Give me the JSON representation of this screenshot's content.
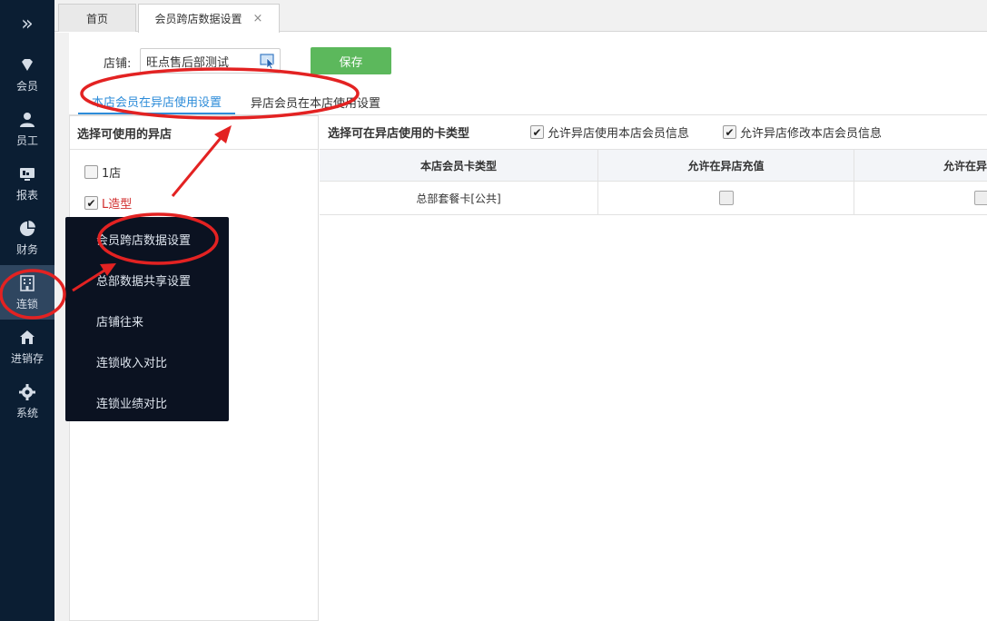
{
  "sidebar": {
    "toggle_icon": "double-chevron-right-icon",
    "items": [
      {
        "label": "会员",
        "icon": "diamond-icon"
      },
      {
        "label": "员工",
        "icon": "user-icon"
      },
      {
        "label": "报表",
        "icon": "monitor-icon"
      },
      {
        "label": "财务",
        "icon": "pie-chart-icon"
      },
      {
        "label": "连锁",
        "icon": "building-icon"
      },
      {
        "label": "进销存",
        "icon": "house-icon"
      },
      {
        "label": "系统",
        "icon": "gear-icon"
      }
    ],
    "active_index": 4
  },
  "tabs": [
    {
      "label": "首页"
    },
    {
      "label": "会员跨店数据设置",
      "close": "×"
    }
  ],
  "form": {
    "store_label": "店铺:",
    "store_value": "旺点售后部测试",
    "save_label": "保存"
  },
  "subtabs": [
    {
      "label": "本店会员在异店使用设置"
    },
    {
      "label": "异店会员在本店使用设置"
    }
  ],
  "left_panel": {
    "title": "选择可使用的异店",
    "stores": [
      {
        "name": "1店",
        "checked": false
      },
      {
        "name": "L造型",
        "checked": true
      }
    ]
  },
  "right_panel": {
    "title": "选择可在异店使用的卡类型",
    "options": [
      {
        "label": "允许异店使用本店会员信息",
        "checked": true
      },
      {
        "label": "允许异店修改本店会员信息",
        "checked": true
      }
    ],
    "columns": [
      "本店会员卡类型",
      "允许在异店充值",
      "允许在异"
    ],
    "rows": [
      {
        "card_type": "总部套餐卡[公共]"
      }
    ]
  },
  "popup_menu": {
    "items": [
      {
        "label": "会员跨店数据设置"
      },
      {
        "label": "总部数据共享设置"
      },
      {
        "label": "店铺往来"
      },
      {
        "label": "连锁收入对比"
      },
      {
        "label": "连锁业绩对比"
      }
    ]
  },
  "colors": {
    "sidebar_bg": "#0b1e33",
    "sidebar_active": "#2f4660",
    "save_button": "#5cb85c",
    "accent": "#2d8cd9",
    "annotation_red": "#e32222",
    "popup_bg": "#0b1221"
  }
}
